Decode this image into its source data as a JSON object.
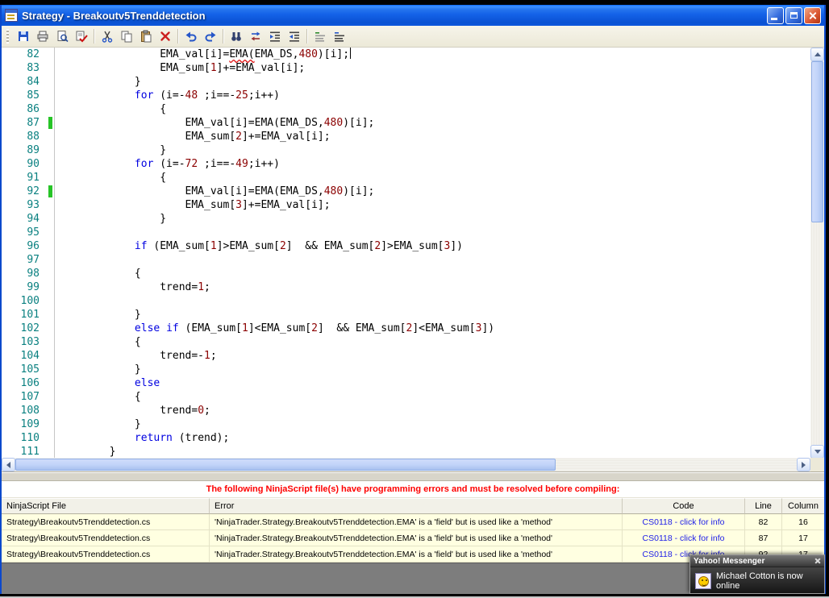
{
  "window": {
    "title": "Strategy - Breakoutv5Trenddetection"
  },
  "toolbar": {
    "icons": [
      "save",
      "print",
      "print-preview",
      "spell-check",
      "cut",
      "copy",
      "paste",
      "delete",
      "undo",
      "redo",
      "find",
      "replace",
      "indent",
      "outdent",
      "comment",
      "uncomment"
    ]
  },
  "editor": {
    "lines": [
      {
        "n": "82",
        "seg": [
          [
            "                EMA_val[i]=",
            ""
          ],
          [
            "EMA(",
            "e"
          ],
          [
            "EMA_DS,",
            ""
          ],
          [
            "480",
            "n"
          ],
          [
            ")[i];",
            ""
          ]
        ],
        "caret": true
      },
      {
        "n": "83",
        "seg": [
          [
            "                EMA_sum[",
            ""
          ],
          [
            "1",
            "n"
          ],
          [
            "]+=EMA_val[i];",
            ""
          ]
        ]
      },
      {
        "n": "84",
        "seg": [
          [
            "            }",
            ""
          ]
        ]
      },
      {
        "n": "85",
        "seg": [
          [
            "            ",
            ""
          ],
          [
            "for",
            "k"
          ],
          [
            " (i=-",
            ""
          ],
          [
            "48",
            "n"
          ],
          [
            " ;i==-",
            ""
          ],
          [
            "25",
            "n"
          ],
          [
            ";i++)",
            ""
          ]
        ]
      },
      {
        "n": "86",
        "seg": [
          [
            "                {",
            ""
          ]
        ]
      },
      {
        "n": "87",
        "seg": [
          [
            "                    EMA_val[i]=EMA(EMA_DS,",
            ""
          ],
          [
            "480",
            "n"
          ],
          [
            ")[i];",
            ""
          ]
        ],
        "changed": true
      },
      {
        "n": "88",
        "seg": [
          [
            "                    EMA_sum[",
            ""
          ],
          [
            "2",
            "n"
          ],
          [
            "]+=EMA_val[i];",
            ""
          ]
        ]
      },
      {
        "n": "89",
        "seg": [
          [
            "                }",
            ""
          ]
        ]
      },
      {
        "n": "90",
        "seg": [
          [
            "            ",
            ""
          ],
          [
            "for",
            "k"
          ],
          [
            " (i=-",
            ""
          ],
          [
            "72",
            "n"
          ],
          [
            " ;i==-",
            ""
          ],
          [
            "49",
            "n"
          ],
          [
            ";i++)",
            ""
          ]
        ]
      },
      {
        "n": "91",
        "seg": [
          [
            "                {",
            ""
          ]
        ]
      },
      {
        "n": "92",
        "seg": [
          [
            "                    EMA_val[i]=EMA(EMA_DS,",
            ""
          ],
          [
            "480",
            "n"
          ],
          [
            ")[i];",
            ""
          ]
        ],
        "changed": true
      },
      {
        "n": "93",
        "seg": [
          [
            "                    EMA_sum[",
            ""
          ],
          [
            "3",
            "n"
          ],
          [
            "]+=EMA_val[i];",
            ""
          ]
        ]
      },
      {
        "n": "94",
        "seg": [
          [
            "                }",
            ""
          ]
        ]
      },
      {
        "n": "95",
        "seg": []
      },
      {
        "n": "96",
        "seg": [
          [
            "            ",
            ""
          ],
          [
            "if",
            "k"
          ],
          [
            " (EMA_sum[",
            ""
          ],
          [
            "1",
            "n"
          ],
          [
            "]>EMA_sum[",
            ""
          ],
          [
            "2",
            "n"
          ],
          [
            "]  && EMA_sum[",
            ""
          ],
          [
            "2",
            "n"
          ],
          [
            "]>EMA_sum[",
            ""
          ],
          [
            "3",
            "n"
          ],
          [
            "])",
            ""
          ]
        ]
      },
      {
        "n": "97",
        "seg": []
      },
      {
        "n": "98",
        "seg": [
          [
            "            {",
            ""
          ]
        ]
      },
      {
        "n": "99",
        "seg": [
          [
            "                trend=",
            ""
          ],
          [
            "1",
            "n"
          ],
          [
            ";",
            ""
          ]
        ]
      },
      {
        "n": "100",
        "seg": []
      },
      {
        "n": "101",
        "seg": [
          [
            "            }",
            ""
          ]
        ]
      },
      {
        "n": "102",
        "seg": [
          [
            "            ",
            ""
          ],
          [
            "else",
            "k"
          ],
          [
            " ",
            ""
          ],
          [
            "if",
            "k"
          ],
          [
            " (EMA_sum[",
            ""
          ],
          [
            "1",
            "n"
          ],
          [
            "]<EMA_sum[",
            ""
          ],
          [
            "2",
            "n"
          ],
          [
            "]  && EMA_sum[",
            ""
          ],
          [
            "2",
            "n"
          ],
          [
            "]<EMA_sum[",
            ""
          ],
          [
            "3",
            "n"
          ],
          [
            "])",
            ""
          ]
        ]
      },
      {
        "n": "103",
        "seg": [
          [
            "            {",
            ""
          ]
        ]
      },
      {
        "n": "104",
        "seg": [
          [
            "                trend=-",
            ""
          ],
          [
            "1",
            "n"
          ],
          [
            ";",
            ""
          ]
        ]
      },
      {
        "n": "105",
        "seg": [
          [
            "            }",
            ""
          ]
        ]
      },
      {
        "n": "106",
        "seg": [
          [
            "            ",
            ""
          ],
          [
            "else",
            "k"
          ]
        ]
      },
      {
        "n": "107",
        "seg": [
          [
            "            {",
            ""
          ]
        ]
      },
      {
        "n": "108",
        "seg": [
          [
            "                trend=",
            ""
          ],
          [
            "0",
            "n"
          ],
          [
            ";",
            ""
          ]
        ]
      },
      {
        "n": "109",
        "seg": [
          [
            "            }",
            ""
          ]
        ]
      },
      {
        "n": "110",
        "seg": [
          [
            "            ",
            ""
          ],
          [
            "return",
            "k"
          ],
          [
            " (trend);",
            ""
          ]
        ]
      },
      {
        "n": "111",
        "seg": [
          [
            "        }",
            ""
          ]
        ]
      }
    ]
  },
  "error_panel": {
    "heading": "The following NinjaScript file(s) have programming errors and must be resolved before compiling:",
    "columns": [
      "NinjaScript File",
      "Error",
      "Code",
      "Line",
      "Column"
    ],
    "rows": [
      {
        "file": "Strategy\\Breakoutv5Trenddetection.cs",
        "error": "'NinjaTrader.Strategy.Breakoutv5Trenddetection.EMA' is a 'field' but is used like a 'method'",
        "code": "CS0118 - click for info",
        "line": "82",
        "column": "16"
      },
      {
        "file": "Strategy\\Breakoutv5Trenddetection.cs",
        "error": "'NinjaTrader.Strategy.Breakoutv5Trenddetection.EMA' is a 'field' but is used like a 'method'",
        "code": "CS0118 - click for info",
        "line": "87",
        "column": "17"
      },
      {
        "file": "Strategy\\Breakoutv5Trenddetection.cs",
        "error": "'NinjaTrader.Strategy.Breakoutv5Trenddetection.EMA' is a 'field' but is used like a 'method'",
        "code": "CS0118 - click for info",
        "line": "92",
        "column": "17"
      }
    ]
  },
  "notification": {
    "title": "Yahoo! Messenger",
    "message": "Michael Cotton is now online"
  },
  "colors": {
    "keyword": "#0000e0",
    "number_literal": "#8b0000",
    "line_number": "#0a8080",
    "error_heading": "#ff0000",
    "error_row_bg": "#ffffe1",
    "link": "#2020e8",
    "titlebar_blue": "#1462e8"
  }
}
